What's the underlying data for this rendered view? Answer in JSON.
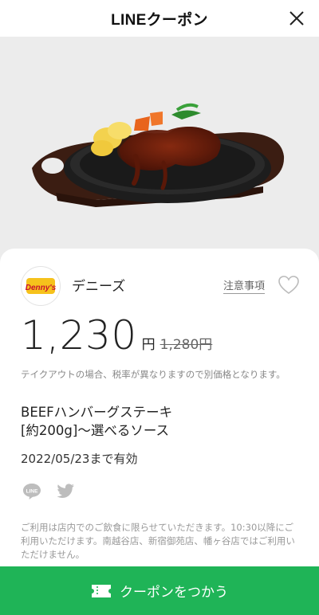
{
  "header": {
    "title": "LINEクーポン"
  },
  "shop": {
    "name": "デニーズ",
    "logo_text": "Denny's",
    "notice_label": "注意事項"
  },
  "price": {
    "value": "1,230",
    "unit": "円",
    "original": "1,280円"
  },
  "tax_note": "テイクアウトの場合、税率が異なりますので別価格となります。",
  "coupon": {
    "title_line1": "BEEFハンバーグステーキ",
    "title_line2": "[約200g]〜選べるソース"
  },
  "expiry": "2022/05/23まで有効",
  "share": {
    "line_icon_text": "LINE"
  },
  "usage_note": "ご利用は店内でのご飲食に限らせていただきます。10:30以降にご利用いただけます。南越谷店、新宿御苑店、幡ヶ谷店ではご利用いただけません。",
  "action": {
    "use_label": "クーポンをつかう"
  },
  "colors": {
    "accent_green": "#1fb457",
    "logo_yellow": "#f6c21c",
    "logo_red": "#c8102e"
  }
}
